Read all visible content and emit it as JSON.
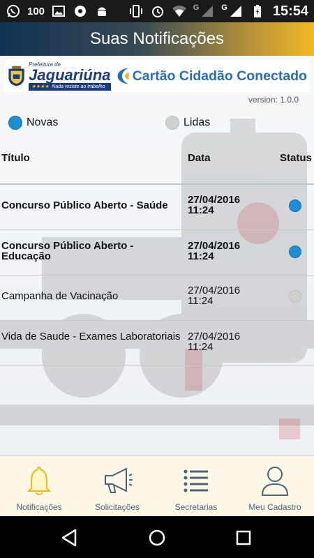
{
  "status_bar": {
    "notification_count": "100",
    "time": "15:54",
    "network_1": "G",
    "network_2": "G",
    "icons": [
      "whatsapp-icon",
      "image-icon",
      "app-icon",
      "android-icon",
      "vibrate-icon",
      "alarm-icon",
      "wifi-icon",
      "signal-icon",
      "battery-icon"
    ]
  },
  "header": {
    "title": "Suas Notificações"
  },
  "branding": {
    "prefeitura_small": "Prefeitura de",
    "prefeitura_name": "Jaguariúna",
    "stars": "★★★★",
    "slogan": "Nada resiste ao trabalho",
    "program_name": "Cartão Cidadão Conectado",
    "version": "version: 1.0.0"
  },
  "legend": {
    "new_label": "Novas",
    "read_label": "Lidas"
  },
  "table": {
    "headers": {
      "title": "Título",
      "date": "Data",
      "status": "Status"
    },
    "rows": [
      {
        "title": "Concurso Público Aberto - Saúde",
        "date": "27/04/2016",
        "time": "11:24",
        "status": "nova"
      },
      {
        "title": "Concurso Público Aberto - Educação",
        "date": "27/04/2016",
        "time": "11:24",
        "status": "nova"
      },
      {
        "title": "Campanha de Vacinação",
        "date": "27/04/2016",
        "time": "11:24",
        "status": "lida"
      },
      {
        "title": "Vida de Saude - Exames Laboratoriais",
        "date": "27/04/2016",
        "time": "11:24",
        "status": "lida"
      }
    ]
  },
  "bottom_nav": {
    "items": [
      {
        "label": "Notificações",
        "icon": "bell-icon"
      },
      {
        "label": "Solicitações",
        "icon": "megaphone-icon"
      },
      {
        "label": "Secretarias",
        "icon": "list-icon"
      },
      {
        "label": "Meu Cadastro",
        "icon": "user-icon"
      }
    ]
  },
  "colors": {
    "new_status": "#1e8ecf",
    "read_status": "#cfcfcf",
    "accent": "#f2b824",
    "nav_bg": "#fdf9e6"
  }
}
